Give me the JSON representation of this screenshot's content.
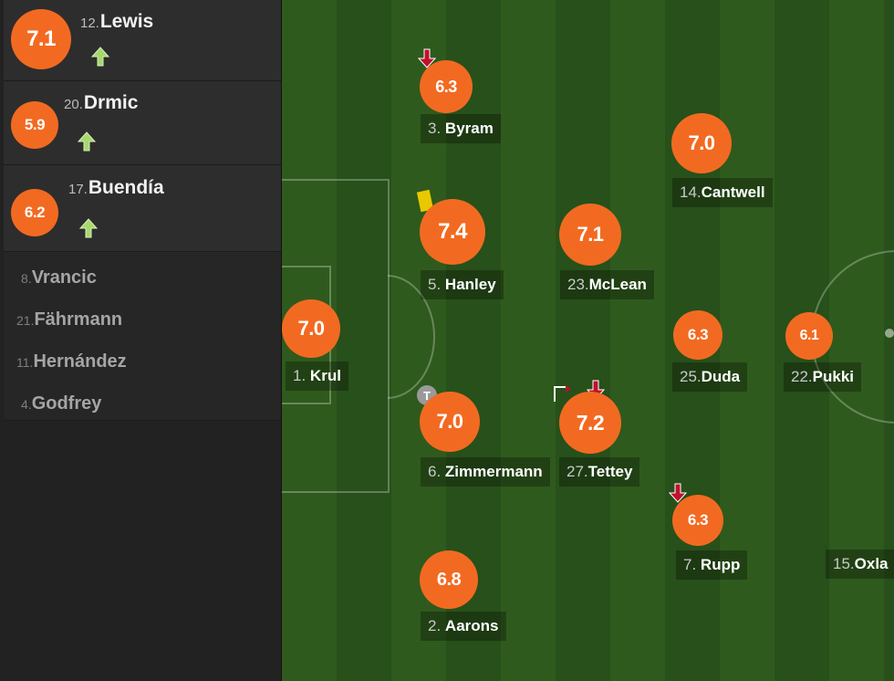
{
  "colors": {
    "rating_badge": "#f26a21",
    "sub_in_arrow": "#a6d86e",
    "sub_out_arrow": "#c0102b",
    "yellow_card": "#e8c800",
    "pitch_light": "#2f5a1d",
    "pitch_dark": "#27501a"
  },
  "substitutes": [
    {
      "rating": "7.1",
      "number": "12.",
      "name": "Lewis",
      "icon": "sub-in-arrow-icon"
    },
    {
      "rating": "5.9",
      "number": "20.",
      "name": "Drmic",
      "icon": "sub-in-arrow-icon"
    },
    {
      "rating": "6.2",
      "number": "17.",
      "name": "Buendía",
      "icon": "sub-in-arrow-icon"
    }
  ],
  "bench": [
    {
      "number": "8.",
      "name": "Vrancic"
    },
    {
      "number": "21.",
      "name": "Fährmann"
    },
    {
      "number": "11.",
      "name": "Hernández"
    },
    {
      "number": "4.",
      "name": "Godfrey"
    }
  ],
  "players": [
    {
      "id": "krul",
      "rating": "7.0",
      "number": "1.",
      "name": "Krul"
    },
    {
      "id": "byram",
      "rating": "6.3",
      "number": "3.",
      "name": "Byram",
      "icon": "sub-out-arrow-icon"
    },
    {
      "id": "hanley",
      "rating": "7.4",
      "number": "5.",
      "name": "Hanley",
      "icon": "yellow-card-icon"
    },
    {
      "id": "zimmermann",
      "rating": "7.0",
      "number": "6.",
      "name": "Zimmermann",
      "icon": "substitution-icon",
      "icon_text": "T"
    },
    {
      "id": "aarons",
      "rating": "6.8",
      "number": "2.",
      "name": "Aarons"
    },
    {
      "id": "mclean",
      "rating": "7.1",
      "number": "23.",
      "name": "McLean"
    },
    {
      "id": "tettey",
      "rating": "7.2",
      "number": "27.",
      "name": "Tettey",
      "icon": "sub-out-arrow-icon",
      "icon2": "corner-flag-icon"
    },
    {
      "id": "cantwell",
      "rating": "7.0",
      "number": "14.",
      "name": "Cantwell"
    },
    {
      "id": "duda",
      "rating": "6.3",
      "number": "25.",
      "name": "Duda"
    },
    {
      "id": "rupp",
      "rating": "6.3",
      "number": "7.",
      "name": "Rupp",
      "icon": "sub-out-arrow-icon"
    },
    {
      "id": "pukki",
      "rating": "6.1",
      "number": "22.",
      "name": "Pukki"
    },
    {
      "id": "oxlade",
      "number": "15.",
      "name": "Oxla"
    }
  ]
}
